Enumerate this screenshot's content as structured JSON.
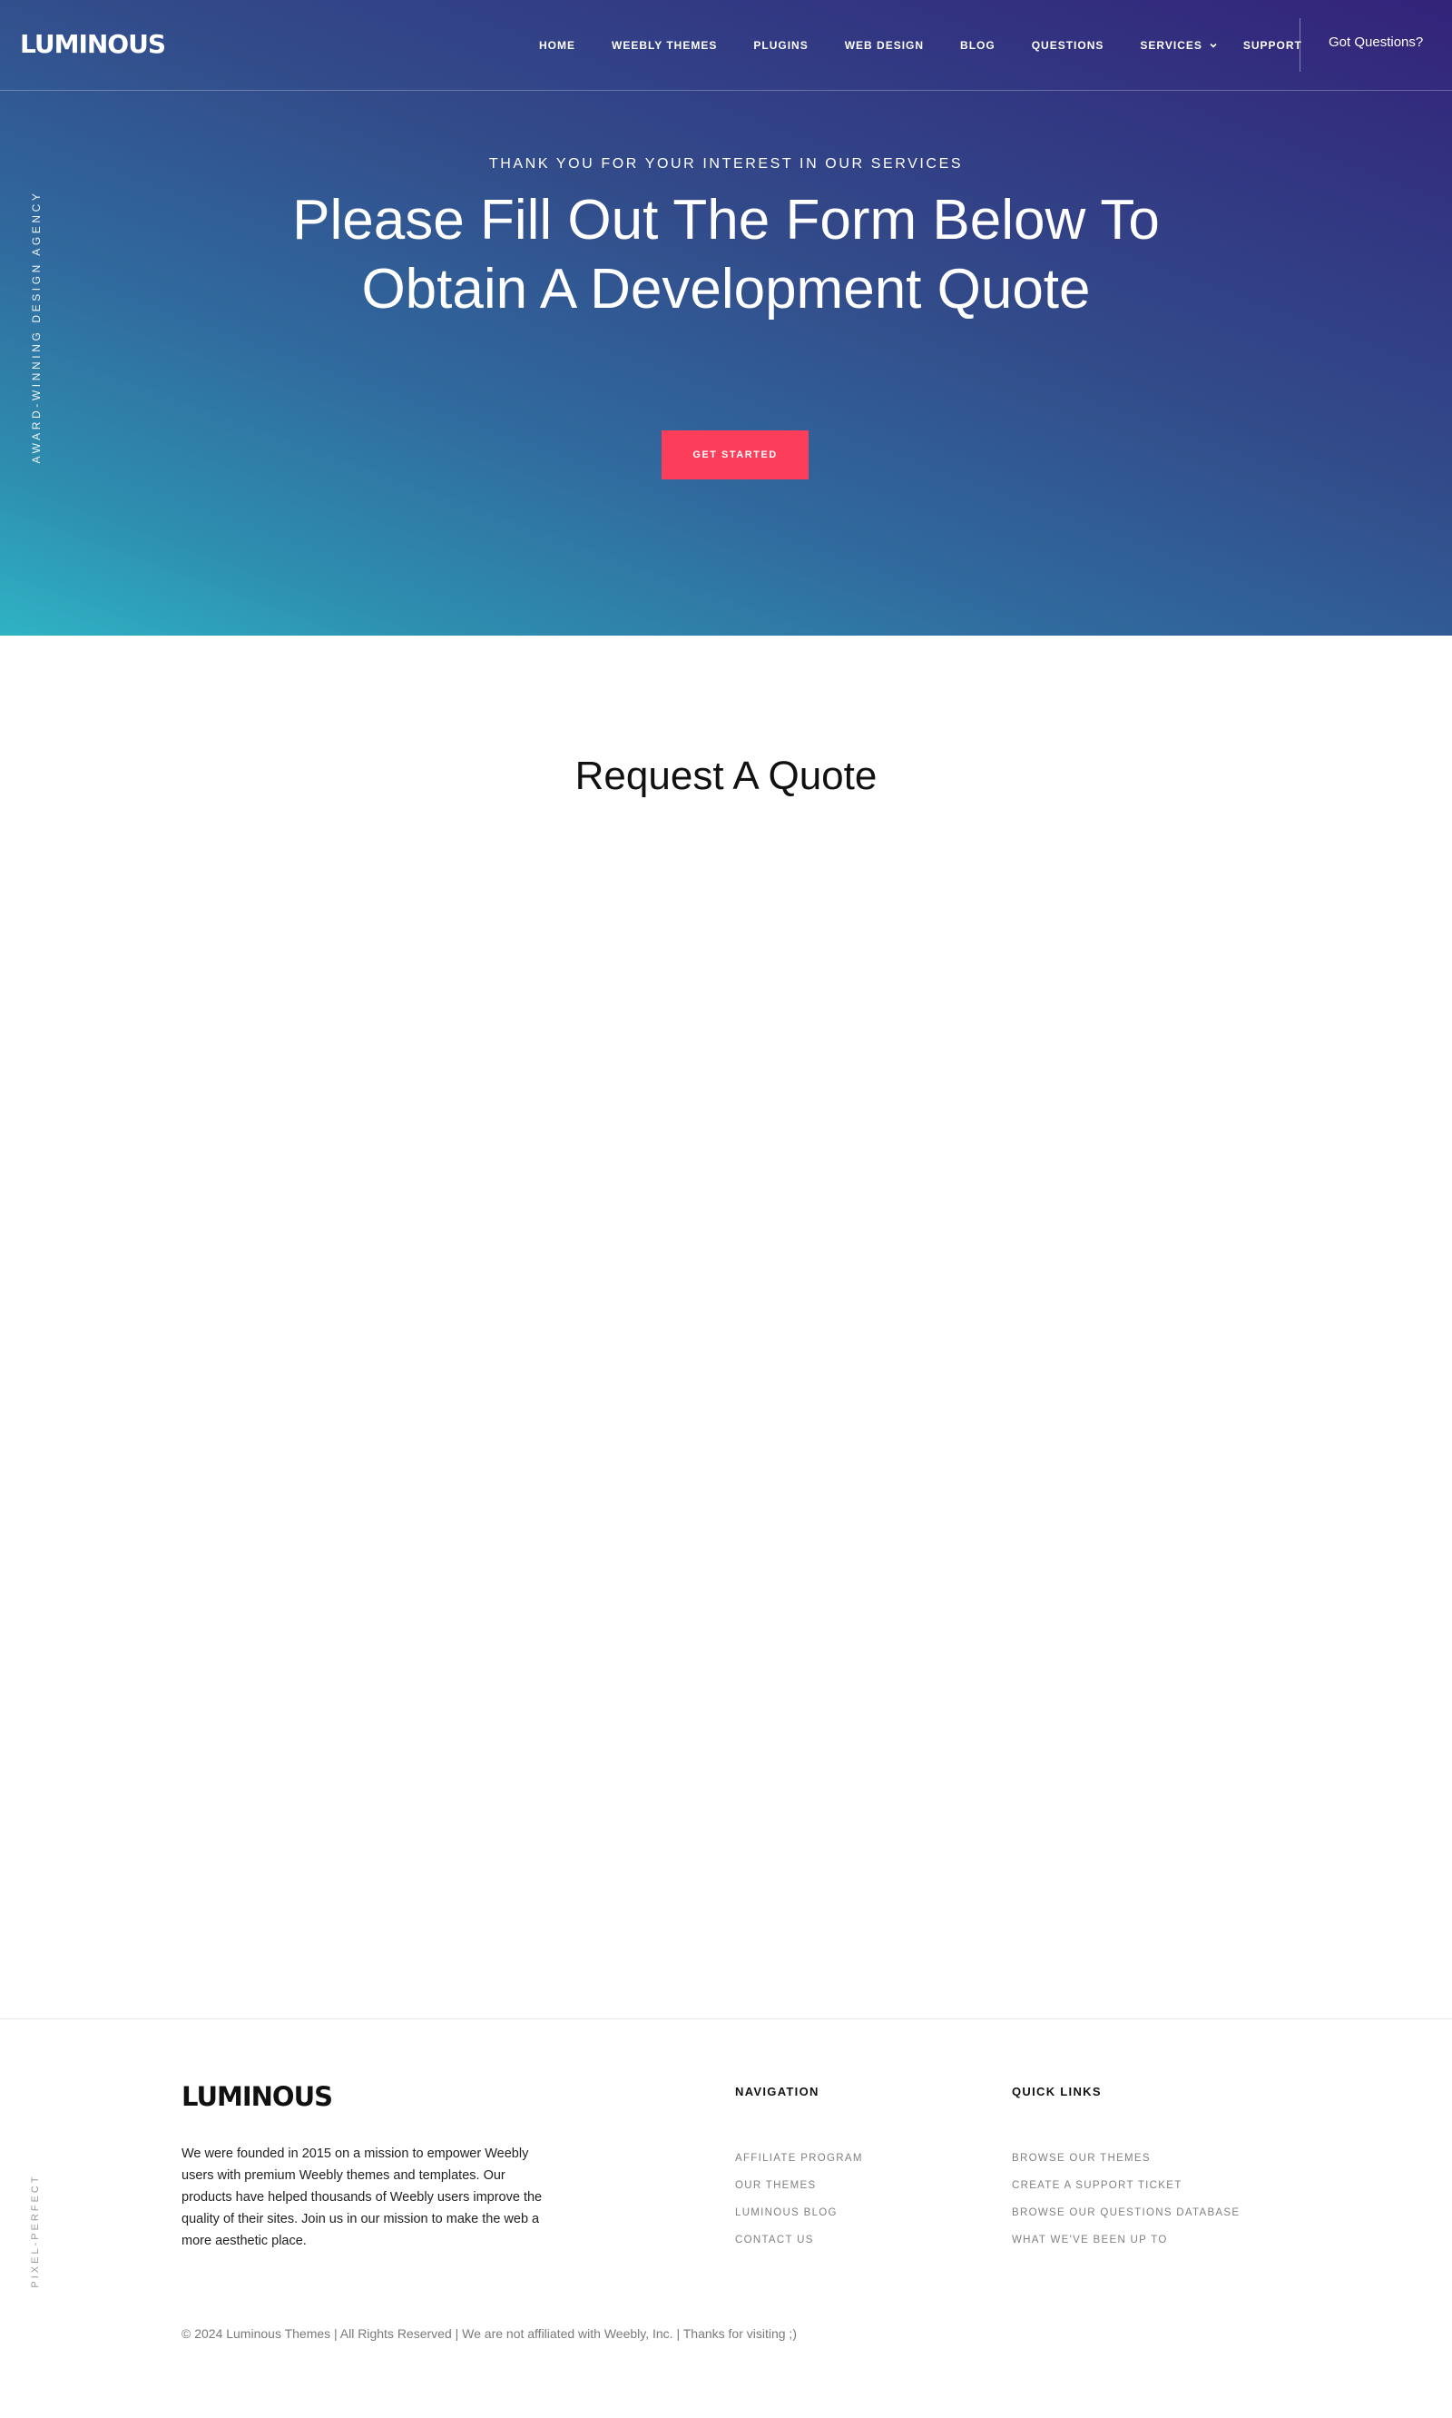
{
  "brand": {
    "logo_text": "LUMINOUS"
  },
  "nav": {
    "items": [
      {
        "label": "HOME"
      },
      {
        "label": "WEEBLY THEMES"
      },
      {
        "label": "PLUGINS"
      },
      {
        "label": "WEB DESIGN"
      },
      {
        "label": "BLOG"
      },
      {
        "label": "QUESTIONS"
      },
      {
        "label": "SERVICES"
      },
      {
        "label": "SUPPORT"
      }
    ],
    "cta_label": "Got Questions?"
  },
  "hero": {
    "side_label": "AWARD-WINNING DESIGN AGENCY",
    "eyebrow": "THANK YOU FOR YOUR INTEREST IN OUR SERVICES",
    "title": "Please Fill Out The Form Below To Obtain A Development Quote",
    "button_label": "GET STARTED",
    "button_color": "#fc3e5a"
  },
  "main": {
    "title": "Request A Quote"
  },
  "footer": {
    "logo_text": "LUMINOUS",
    "about": "We were founded in 2015 on a mission to empower Weebly users with premium Weebly themes and templates. Our products have helped thousands of Weebly users improve the quality of their sites. Join us in our mission to make the web a more aesthetic place.",
    "side_label": "PIXEL-PERFECT",
    "navigation": {
      "title": "NAVIGATION",
      "links": [
        "AFFILIATE PROGRAM",
        "OUR THEMES",
        "LUMINOUS BLOG",
        "CONTACT US"
      ]
    },
    "quick_links": {
      "title": "QUICK LINKS",
      "links": [
        "BROWSE OUR THEMES",
        "CREATE A SUPPORT TICKET",
        "BROWSE OUR QUESTIONS DATABASE",
        "WHAT WE'VE BEEN UP TO"
      ]
    },
    "copyright": "© 2024 Luminous Themes | All Rights Reserved | We are not affiliated with Weebly, Inc. | Thanks for visiting ;)"
  }
}
